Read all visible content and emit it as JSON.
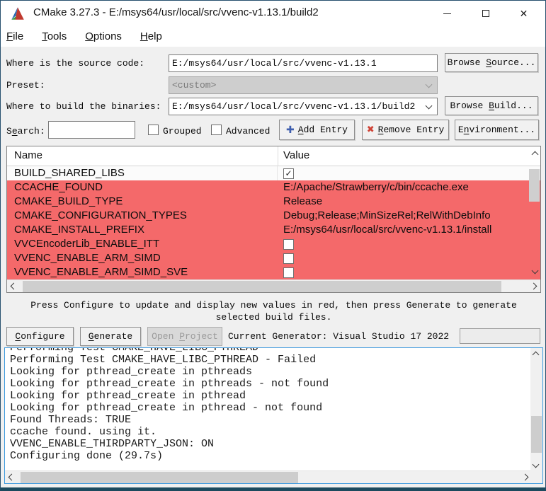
{
  "window": {
    "title": "CMake 3.27.3 - E:/msys64/usr/local/src/vvenc-v1.13.1/build2"
  },
  "menu": {
    "file": "File",
    "tools": "Tools",
    "options": "Options",
    "help": "Help"
  },
  "form": {
    "source_label": "Where is the source code:",
    "source_value": "E:/msys64/usr/local/src/vvenc-v1.13.1",
    "browse_source": {
      "pre": "Browse ",
      "u": "S",
      "post": "ource..."
    },
    "preset_label": "Preset:",
    "preset_value": "<custom>",
    "build_label": "Where to build the binaries:",
    "build_value": "E:/msys64/usr/local/src/vvenc-v1.13.1/build2",
    "browse_build": {
      "pre": "Browse ",
      "u": "B",
      "post": "uild..."
    }
  },
  "search": {
    "label": {
      "pre": "S",
      "u": "e",
      "post": "arch:"
    },
    "value": "",
    "grouped_label": "Grouped",
    "advanced_label": "Advanced",
    "add_entry": {
      "pre": "",
      "u": "A",
      "post": "dd Entry"
    },
    "remove_entry": {
      "pre": "",
      "u": "R",
      "post": "emove Entry"
    },
    "environment": {
      "pre": "E",
      "u": "n",
      "post": "vironment..."
    }
  },
  "table": {
    "name_header": "Name",
    "value_header": "Value",
    "rows": [
      {
        "name": "BUILD_SHARED_LIBS",
        "type": "checkbox",
        "checked": true,
        "red": false,
        "value": ""
      },
      {
        "name": "CCACHE_FOUND",
        "type": "text",
        "red": true,
        "value": "E:/Apache/Strawberry/c/bin/ccache.exe"
      },
      {
        "name": "CMAKE_BUILD_TYPE",
        "type": "text",
        "red": true,
        "value": "Release"
      },
      {
        "name": "CMAKE_CONFIGURATION_TYPES",
        "type": "text",
        "red": true,
        "value": "Debug;Release;MinSizeRel;RelWithDebInfo"
      },
      {
        "name": "CMAKE_INSTALL_PREFIX",
        "type": "text",
        "red": true,
        "value": "E:/msys64/usr/local/src/vvenc-v1.13.1/install"
      },
      {
        "name": "VVCEncoderLib_ENABLE_ITT",
        "type": "checkbox",
        "checked": false,
        "red": true,
        "value": ""
      },
      {
        "name": "VVENC_ENABLE_ARM_SIMD",
        "type": "checkbox",
        "checked": false,
        "red": true,
        "value": ""
      },
      {
        "name": "VVENC_ENABLE_ARM_SIMD_SVE",
        "type": "checkbox",
        "checked": false,
        "red": true,
        "value": ""
      }
    ]
  },
  "hint": {
    "line1": "Press Configure to update and display new values in red, then press Generate to generate",
    "line2": "selected build files."
  },
  "actions": {
    "configure": {
      "pre": "",
      "u": "C",
      "post": "onfigure"
    },
    "generate": {
      "pre": "",
      "u": "G",
      "post": "enerate"
    },
    "open_project": {
      "pre": "Open ",
      "u": "P",
      "post": "roject"
    },
    "generator_label": "Current Generator: Visual Studio 17 2022"
  },
  "log": {
    "lines": [
      "Performing Test CMAKE_HAVE_LIBC_PTHREAD",
      "Performing Test CMAKE_HAVE_LIBC_PTHREAD - Failed",
      "Looking for pthread_create in pthreads",
      "Looking for pthread_create in pthreads - not found",
      "Looking for pthread_create in pthread",
      "Looking for pthread_create in pthread - not found",
      "Found Threads: TRUE",
      "ccache found. using it.",
      "VVENC_ENABLE_THIRDPARTY_JSON: ON",
      "Configuring done (29.7s)"
    ]
  },
  "colors": {
    "red_row": "#f4696a",
    "log_border": "#3e9ade"
  }
}
